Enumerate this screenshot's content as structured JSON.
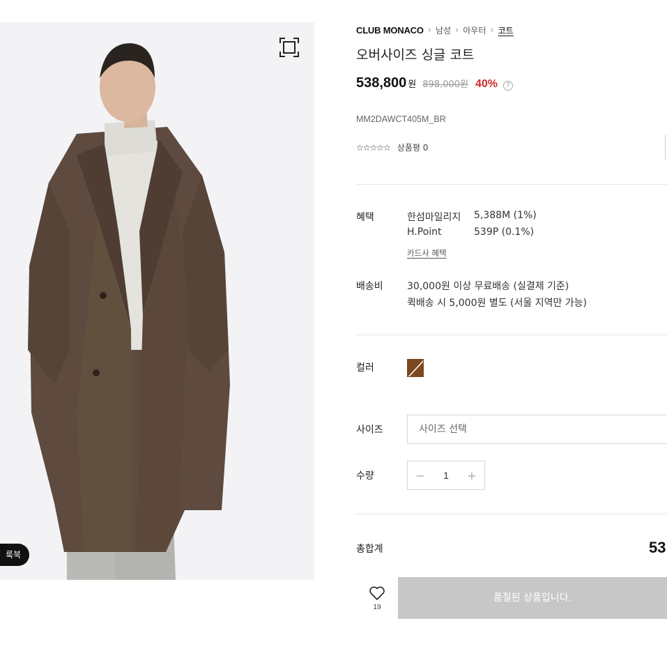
{
  "breadcrumb": {
    "brand": "CLUB MONACO",
    "items": [
      "남성",
      "아우터",
      "코트"
    ]
  },
  "product": {
    "title": "오버사이즈 싱글 코트",
    "price": "538,800",
    "currency": "원",
    "original_price": "898,000원",
    "discount": "40%",
    "help_glyph": "?",
    "sku": "MM2DAWCT405M_BR"
  },
  "rating": {
    "stars": "☆☆☆☆☆",
    "label": "상품평 0"
  },
  "benefits": {
    "label": "혜택",
    "rows": [
      {
        "name": "한섬마일리지",
        "value": "5,388M (1%)"
      },
      {
        "name": "H.Point",
        "value": "539P (0.1%)"
      }
    ],
    "card_link": "카드사 혜택"
  },
  "shipping": {
    "label": "배송비",
    "lines": [
      "30,000원 이상 무료배송 (실결제 기준)",
      "퀵배송 시 5,000원 별도 (서울 지역만 가능)"
    ]
  },
  "color": {
    "label": "컬러",
    "swatch_color": "#7a4a22"
  },
  "size": {
    "label": "사이즈",
    "placeholder": "사이즈 선택"
  },
  "quantity": {
    "label": "수량",
    "minus": "−",
    "value": "1",
    "plus": "+"
  },
  "total": {
    "label": "총합계",
    "value": "53"
  },
  "actions": {
    "wish_count": "19",
    "soldout_label": "품절된 상품입니다."
  },
  "image": {
    "lookbook_label": "룩북"
  },
  "colors": {
    "discount_red": "#d12b2b",
    "soldout_gray": "#c7c7c7"
  }
}
